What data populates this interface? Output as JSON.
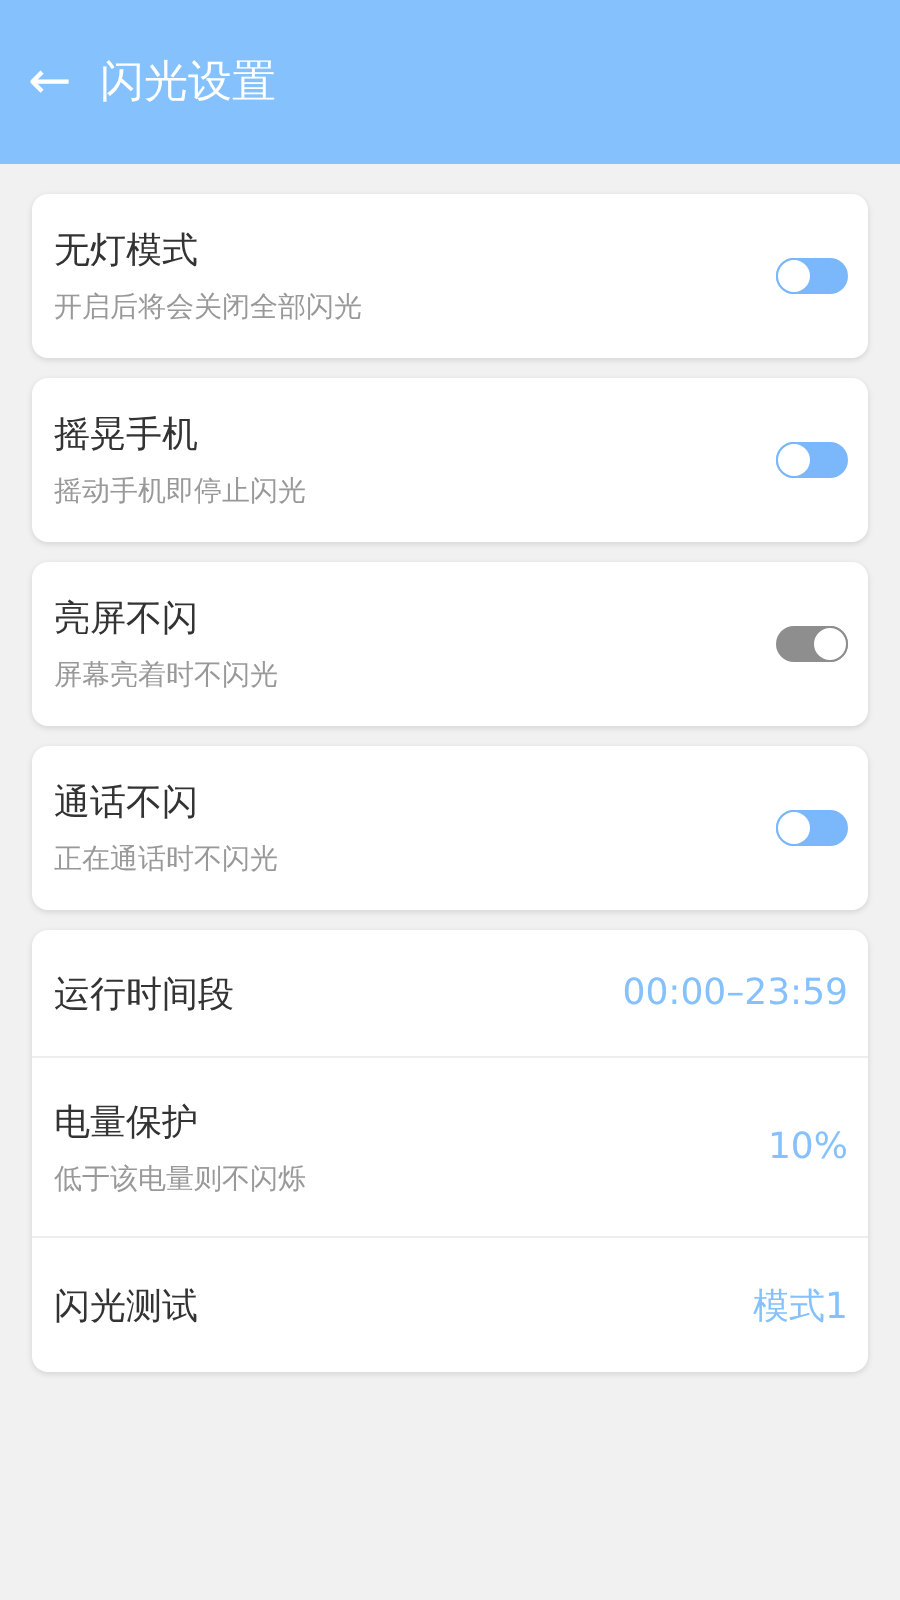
{
  "header": {
    "back_icon": "←",
    "title": "闪光设置"
  },
  "toggles": [
    {
      "title": "无灯模式",
      "subtitle": "开启后将会关闭全部闪光",
      "on": false
    },
    {
      "title": "摇晃手机",
      "subtitle": "摇动手机即停止闪光",
      "on": false
    },
    {
      "title": "亮屏不闪",
      "subtitle": "屏幕亮着时不闪光",
      "on": true
    },
    {
      "title": "通话不闪",
      "subtitle": "正在通话时不闪光",
      "on": false
    }
  ],
  "settings": [
    {
      "title": "运行时间段",
      "value": "00:00–23:59"
    },
    {
      "title": "电量保护",
      "subtitle": "低于该电量则不闪烁",
      "value": "10%"
    },
    {
      "title": "闪光测试",
      "value": "模式1"
    }
  ]
}
